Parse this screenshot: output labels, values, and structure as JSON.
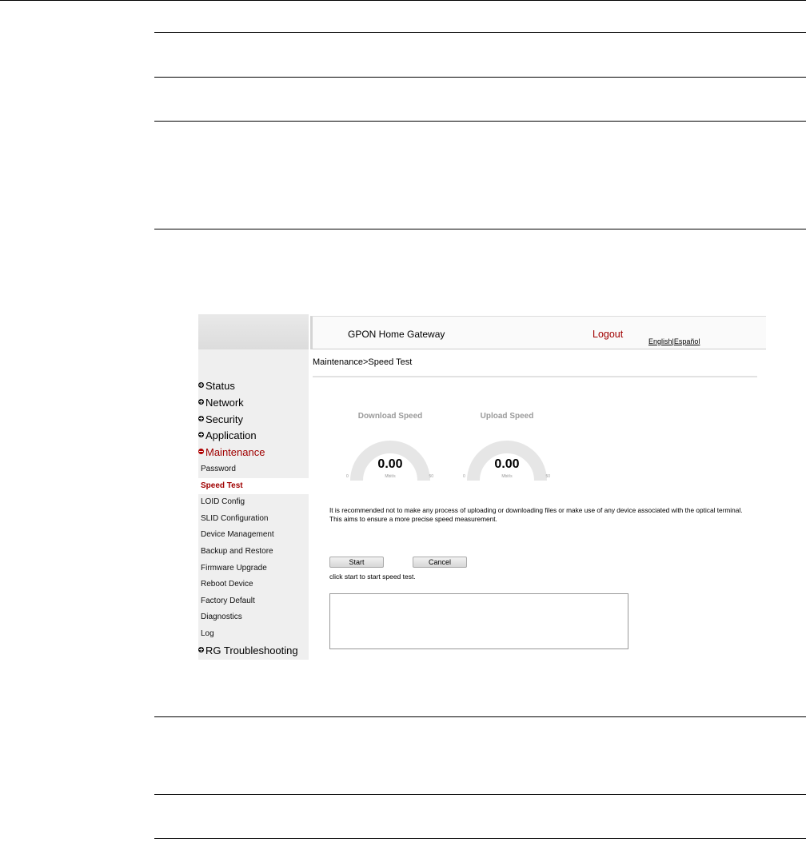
{
  "header": {
    "app_title": "GPON Home Gateway",
    "logout": "Logout",
    "lang_english": "English",
    "lang_separator": "|",
    "lang_spanish": "Español"
  },
  "breadcrumb": "Maintenance>Speed Test",
  "sidebar": {
    "categories": [
      {
        "label": "Status",
        "expanded": false
      },
      {
        "label": "Network",
        "expanded": false
      },
      {
        "label": "Security",
        "expanded": false
      },
      {
        "label": "Application",
        "expanded": false
      },
      {
        "label": "Maintenance",
        "expanded": true
      },
      {
        "label": "RG Troubleshooting",
        "expanded": false
      }
    ],
    "maintenance_items": [
      {
        "label": "Password",
        "active": false
      },
      {
        "label": "Speed Test",
        "active": true
      },
      {
        "label": "LOID Config",
        "active": false
      },
      {
        "label": "SLID Configuration",
        "active": false
      },
      {
        "label": "Device Management",
        "active": false
      },
      {
        "label": "Backup and Restore",
        "active": false
      },
      {
        "label": "Firmware Upgrade",
        "active": false
      },
      {
        "label": "Reboot Device",
        "active": false
      },
      {
        "label": "Factory Default",
        "active": false
      },
      {
        "label": "Diagnostics",
        "active": false
      },
      {
        "label": "Log",
        "active": false
      }
    ]
  },
  "download_gauge": {
    "title": "Download Speed",
    "value": "0.00",
    "unit": "Mbit/s",
    "min": "0",
    "max": "50",
    "level": 0
  },
  "upload_gauge": {
    "title": "Upload Speed",
    "value": "0.00",
    "unit": "Mbit/s",
    "min": "0",
    "max": "50",
    "level": 0
  },
  "notice": {
    "line1": "It is recommended not to make any process of uploading or downloading files or make use of any device associated with the optical terminal.",
    "line2": "This aims to ensure a more precise speed measurement."
  },
  "buttons": {
    "start": "Start",
    "cancel": "Cancel"
  },
  "hint": "click start to start speed test.",
  "result_box": "",
  "colors": {
    "accent": "#a00000",
    "gauge_track": "#e6e6e6",
    "sidebar_bg": "#efefef"
  }
}
